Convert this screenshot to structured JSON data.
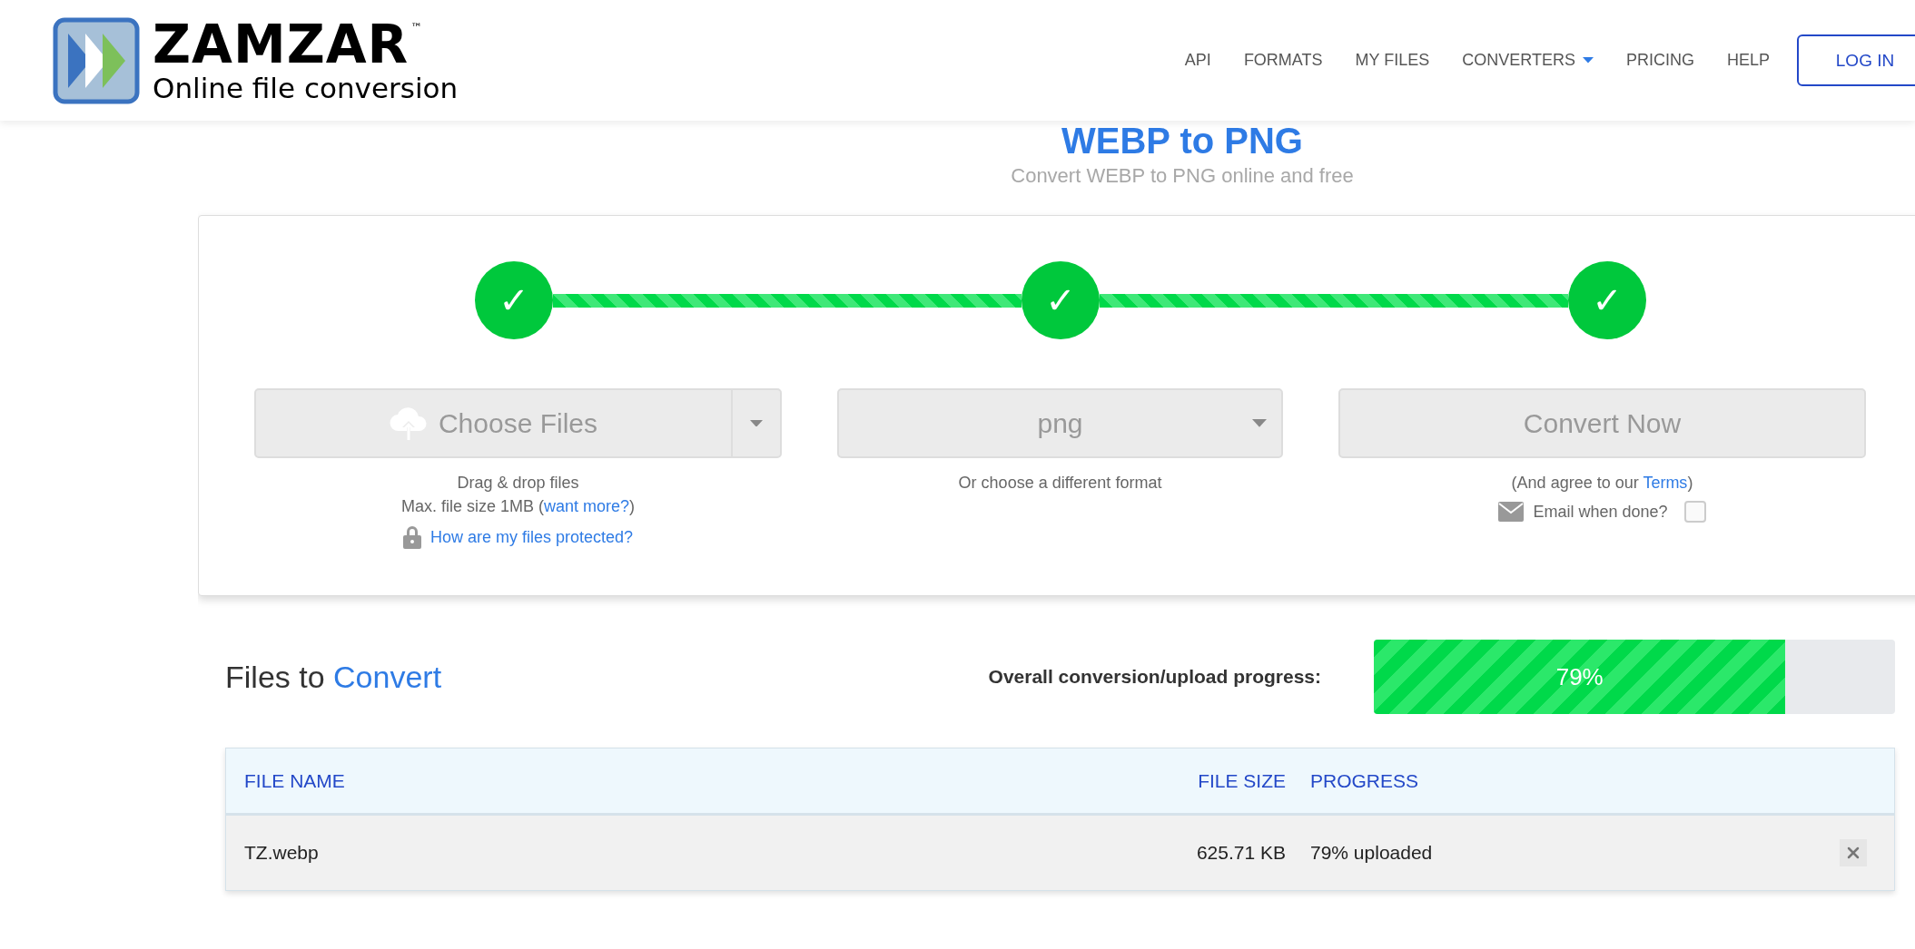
{
  "header": {
    "logo": {
      "name": "ZAMZAR",
      "trademark": "™",
      "tagline": "Online file conversion"
    },
    "nav": [
      {
        "label": "API",
        "has_menu": false
      },
      {
        "label": "FORMATS",
        "has_menu": false
      },
      {
        "label": "MY FILES",
        "has_menu": false
      },
      {
        "label": "CONVERTERS",
        "has_menu": true
      },
      {
        "label": "PRICING",
        "has_menu": false
      },
      {
        "label": "HELP",
        "has_menu": false
      }
    ],
    "login": "LOG IN"
  },
  "page": {
    "title": "WEBP to PNG",
    "subtitle": "Convert WEBP to PNG online and free"
  },
  "steps": [
    {
      "mark": "✓",
      "done": true
    },
    {
      "mark": "✓",
      "done": true
    },
    {
      "mark": "✓",
      "done": true
    }
  ],
  "choose": {
    "label": "Choose Files",
    "hint": "Drag & drop files",
    "limit": {
      "before": "Max. file size 1MB (",
      "link": "want more?",
      "after": ")"
    },
    "protect_link": "How are my files protected?"
  },
  "format": {
    "value": "png",
    "hint": "Or choose a different format"
  },
  "convert": {
    "label": "Convert Now",
    "terms": {
      "before": "(And agree to our ",
      "link": "Terms",
      "after": ")"
    },
    "email": {
      "label": "Email when done?",
      "checked": false
    }
  },
  "files": {
    "title": "Files to",
    "title_accent": "Convert",
    "progress_label": "Overall conversion/upload progress:",
    "progress": {
      "level": 0.79,
      "reading": "79%"
    },
    "columns": [
      "FILE NAME",
      "FILE SIZE",
      "PROGRESS"
    ],
    "rows": [
      {
        "name": "TZ.webp",
        "size": "625.71 KB",
        "progress": "79% uploaded"
      }
    ]
  }
}
